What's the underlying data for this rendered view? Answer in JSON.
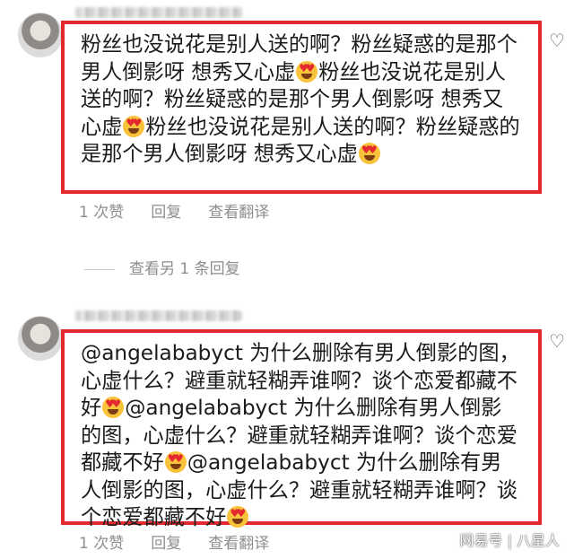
{
  "comments": [
    {
      "text_segments": [
        "粉丝也没说花是别人送的啊？粉丝疑惑的是那个男人倒影呀 想秀又心虚",
        "粉丝也没说花是别人送的啊？粉丝疑惑的是那个男人倒影呀 想秀又心虚",
        "粉丝也没说花是别人送的啊？粉丝疑惑的是那个男人倒影呀 想秀又心虚"
      ],
      "emoji_icon": "heart-eyes-emoji",
      "likes": "1 次赞",
      "reply": "回复",
      "translate": "查看翻译"
    },
    {
      "text_segments": [
        "@angelababyct 为什么删除有男人倒影的图，心虚什么？避重就轻糊弄谁啊？谈个恋爱都藏不好",
        "@angelababyct 为什么删除有男人倒影的图，心虚什么？避重就轻糊弄谁啊？谈个恋爱都藏不好",
        "@angelababyct 为什么删除有男人倒影的图，心虚什么？避重就轻糊弄谁啊？谈个恋爱都藏不好"
      ],
      "emoji_icon": "heart-eyes-emoji",
      "likes": "1 次赞",
      "reply": "回复",
      "translate": "查看翻译"
    }
  ],
  "more_replies": "查看另 1 条回复",
  "watermark": "网易号 | 八星人",
  "colors": {
    "highlight_border": "#e4282f",
    "meta_text": "#8e8e8e"
  }
}
